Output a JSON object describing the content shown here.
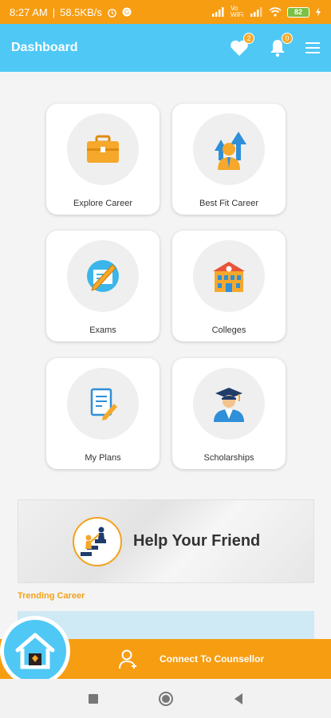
{
  "status": {
    "time": "8:27 AM",
    "speed": "58.5KB/s",
    "network": "Vo WiFi",
    "battery": "82"
  },
  "header": {
    "title": "Dashboard",
    "favorites_count": "2",
    "notifications_count": "0"
  },
  "cards": [
    {
      "label": "Explore Career",
      "icon": "briefcase-icon"
    },
    {
      "label": "Best Fit Career",
      "icon": "career-growth-icon"
    },
    {
      "label": "Exams",
      "icon": "exam-pencil-icon"
    },
    {
      "label": "Colleges",
      "icon": "college-building-icon"
    },
    {
      "label": "My Plans",
      "icon": "plan-document-icon"
    },
    {
      "label": "Scholarships",
      "icon": "graduate-icon"
    }
  ],
  "banner": {
    "text": "Help Your Friend"
  },
  "trending": {
    "title": "Trending Career"
  },
  "bottom": {
    "counsellor_label": "Connect To Counsellor"
  },
  "colors": {
    "accent": "#f79d12",
    "header": "#4fc8f5",
    "badge": "#f7a928"
  }
}
